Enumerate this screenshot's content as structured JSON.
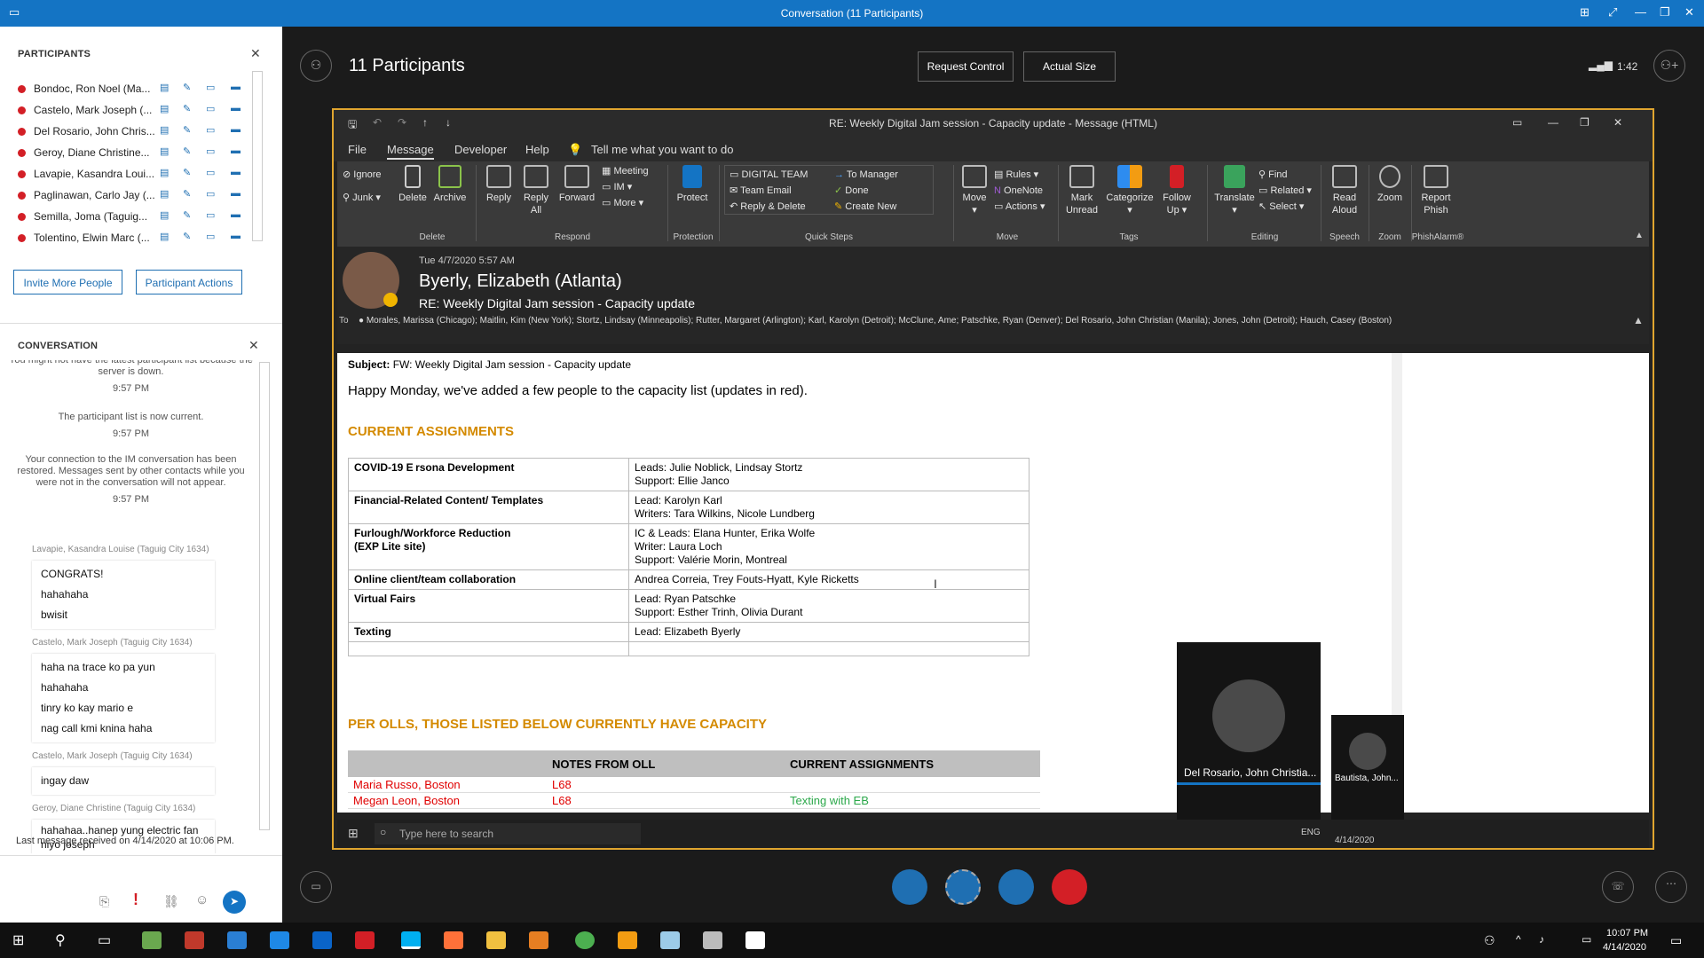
{
  "window": {
    "title": "Conversation (11 Participants)"
  },
  "participants_panel": {
    "title": "PARTICIPANTS",
    "people": [
      {
        "name": "Bondoc, Ron Noel (Ma..."
      },
      {
        "name": "Castelo, Mark Joseph (..."
      },
      {
        "name": "Del Rosario, John Chris..."
      },
      {
        "name": "Geroy, Diane Christine..."
      },
      {
        "name": "Lavapie, Kasandra Loui..."
      },
      {
        "name": "Paglinawan, Carlo Jay (..."
      },
      {
        "name": "Semilla, Joma (Taguig..."
      },
      {
        "name": "Tolentino, Elwin Marc (..."
      }
    ],
    "invite_label": "Invite More People",
    "actions_label": "Participant Actions"
  },
  "conversation": {
    "title": "CONVERSATION",
    "sys": [
      {
        "text": "You might not have the latest participant list because the server is down.",
        "time": "9:57 PM"
      },
      {
        "text": "The participant list is now current.",
        "time": "9:57 PM"
      },
      {
        "text": "Your connection to the IM conversation has been restored. Messages sent by other contacts while you were not in the conversation will not appear.",
        "time": "9:57 PM"
      }
    ],
    "groups": [
      {
        "sender": "Lavapie, Kasandra Louise (Taguig City 1634)",
        "lines": [
          "CONGRATS!",
          "hahahaha",
          "bwisit"
        ]
      },
      {
        "sender": "Castelo, Mark Joseph (Taguig City 1634)",
        "lines": [
          "haha na trace ko pa yun",
          "hahahaha",
          "tinry ko kay mario e",
          "nag call kmi knina haha"
        ]
      },
      {
        "sender": "Castelo, Mark Joseph (Taguig City 1634)",
        "lines": [
          "ingay daw"
        ]
      },
      {
        "sender": "Geroy, Diane Christine (Taguig City 1634)",
        "lines": [
          "hahahaa..hanep yung electric fan niyo joseph"
        ]
      }
    ],
    "last_received": "Last message received on 4/14/2020 at 10:06 PM."
  },
  "stage": {
    "participants_count": "11 Participants",
    "request_control": "Request Control",
    "actual_size": "Actual Size",
    "timer": "1:42"
  },
  "outlook": {
    "title": "RE: Weekly Digital Jam session - Capacity update  -  Message (HTML)",
    "menu": [
      "File",
      "Message",
      "Developer",
      "Help"
    ],
    "tell_me": "Tell me what you want to do",
    "ribbon": {
      "ignore": "Ignore",
      "junk": "Junk",
      "delete": "Delete",
      "archive": "Archive",
      "reply": "Reply",
      "reply_all": "Reply All",
      "forward": "Forward",
      "meeting": "Meeting",
      "im": "IM",
      "more": "More",
      "protect": "Protect",
      "digital_team": "DIGITAL TEAM",
      "team_email": "Team Email",
      "reply_delete": "Reply & Delete",
      "to_manager": "To Manager",
      "done": "Done",
      "create_new": "Create New",
      "move": "Move",
      "rules": "Rules",
      "onenote": "OneNote",
      "actions": "Actions",
      "mark_unread": "Mark Unread",
      "categorize": "Categorize",
      "follow_up": "Follow Up",
      "translate": "Translate",
      "find": "Find",
      "related": "Related",
      "select": "Select",
      "read_aloud": "Read Aloud",
      "zoom": "Zoom",
      "report_phish": "Report Phish",
      "groups": [
        "Delete",
        "Respond",
        "Protection",
        "Quick Steps",
        "Move",
        "Tags",
        "Editing",
        "Speech",
        "Zoom",
        "PhishAlarm®"
      ]
    },
    "date": "Tue 4/7/2020 5:57 AM",
    "sender": "Byerly, Elizabeth (Atlanta)",
    "subject_line": "RE: Weekly Digital Jam session - Capacity update",
    "to_label": "To",
    "to": "Morales, Marissa (Chicago);  Maitlin, Kim (New York);  Stortz, Lindsay (Minneapolis);  Rutter, Margaret (Arlington);  Karl, Karolyn (Detroit);  McClune, Ame;  Patschke, Ryan (Denver);  Del Rosario, John Christian (Manila);  Jones, John (Detroit);  Hauch, Casey (Boston)",
    "body": {
      "subject_label": "Subject:",
      "subject": "FW: Weekly Digital Jam session - Capacity update",
      "intro": "Happy Monday, we've added a few people to the capacity list (updates in red).",
      "h1": "CURRENT ASSIGNMENTS",
      "rows": [
        {
          "k": "COVID-19 E rsona Development",
          "v": [
            "Leads: Julie Noblick, Lindsay Stortz",
            "Support: Ellie Janco"
          ]
        },
        {
          "k": "Financial-Related Content/ Templates",
          "v": [
            "Lead: Karolyn Karl",
            "Writers: Tara Wilkins, Nicole Lundberg"
          ]
        },
        {
          "k": "Furlough/Workforce Reduction\n(EXP Lite site)",
          "v": [
            "IC & Leads: Elana Hunter, Erika Wolfe",
            "Writer: Laura Loch",
            "Support: Valérie Morin, Montreal"
          ]
        },
        {
          "k": "Online client/team collaboration",
          "v": [
            "Andrea Correia, Trey Fouts-Hyatt, Kyle Ricketts"
          ]
        },
        {
          "k": "Virtual Fairs",
          "v": [
            "Lead: Ryan Patschke",
            "Support: Esther Trinh, Olivia Durant"
          ]
        },
        {
          "k": "Texting",
          "v": [
            "Lead: Elizabeth Byerly"
          ]
        }
      ],
      "h2": "PER OLLS, THOSE LISTED BELOW CURRENTLY HAVE CAPACITY",
      "cap_headers": [
        "",
        "NOTES FROM OLL",
        "CURRENT ASSIGNMENTS"
      ],
      "cap_rows": [
        {
          "name": "Maria Russo, Boston",
          "note": "L68",
          "assign": ""
        },
        {
          "name": "Megan Leon, Boston",
          "note": "L68",
          "assign": "Texting with EB"
        }
      ]
    },
    "search_placeholder": "Type here to search",
    "inner_tray": {
      "lang": "ENG",
      "date": "4/14/2020"
    }
  },
  "video": {
    "main_name": "Del Rosario, John Christia...",
    "small_name": "Bautista, John..."
  },
  "taskbar": {
    "time": "10:07 PM",
    "date": "4/14/2020"
  }
}
